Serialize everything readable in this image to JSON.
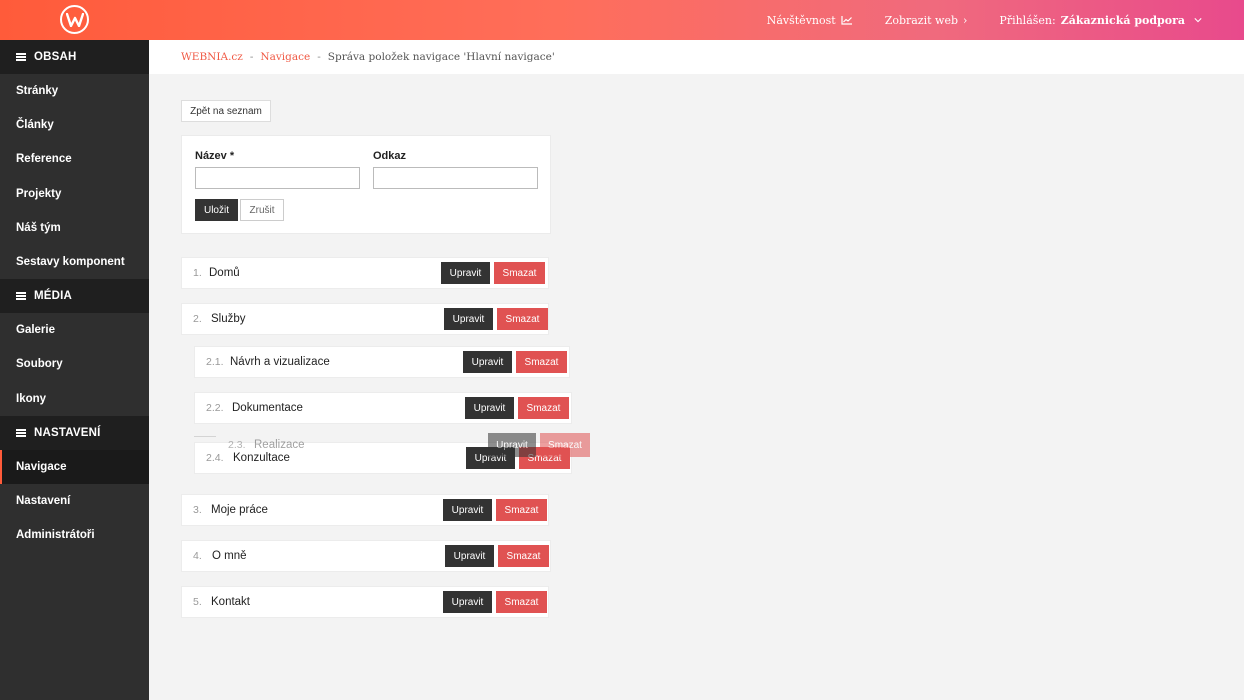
{
  "topbar": {
    "logo_icon": "webnia-w-logo",
    "visits_label": "Návštěvnost",
    "show_web_label": "Zobrazit web",
    "logged_in_label": "Přihlášen:",
    "user_name": "Zákaznická podpora"
  },
  "sidebar": {
    "sections": [
      {
        "title": "OBSAH",
        "items": [
          "Stránky",
          "Články",
          "Reference",
          "Projekty",
          "Náš tým",
          "Sestavy komponent"
        ]
      },
      {
        "title": "MÉDIA",
        "items": [
          "Galerie",
          "Soubory",
          "Ikony"
        ]
      },
      {
        "title": "NASTAVENÍ",
        "items": [
          "Navigace",
          "Nastavení",
          "Administrátoři"
        ]
      }
    ],
    "active_item": "Navigace"
  },
  "breadcrumb": {
    "items": [
      "WEBNIA.cz",
      "Navigace",
      "Správa položek navigace 'Hlavní navigace'"
    ],
    "separator": "-"
  },
  "back_button": "Zpět na seznam",
  "form": {
    "name_label": "Název *",
    "name_value": "",
    "link_label": "Odkaz",
    "link_value": "",
    "save_label": "Uložit",
    "cancel_label": "Zrušit"
  },
  "nav_items": [
    {
      "num": "1.",
      "name": "Domů",
      "edit": "Upravit",
      "delete": "Smazat"
    },
    {
      "num": "2.",
      "name": "Služby",
      "edit": "Upravit",
      "delete": "Smazat"
    },
    {
      "num": "2.1.",
      "name": "Návrh a vizualizace",
      "edit": "Upravit",
      "delete": "Smazat"
    },
    {
      "num": "2.2.",
      "name": "Dokumentace",
      "edit": "Upravit",
      "delete": "Smazat"
    },
    {
      "num": "2.4.",
      "name": "Konzultace",
      "edit": "Upravit",
      "delete": "Smazat"
    },
    {
      "num": "3.",
      "name": "Moje práce",
      "edit": "Upravit",
      "delete": "Smazat"
    },
    {
      "num": "4.",
      "name": "O mně",
      "edit": "Upravit",
      "delete": "Smazat"
    },
    {
      "num": "5.",
      "name": "Kontakt",
      "edit": "Upravit",
      "delete": "Smazat"
    }
  ],
  "dragging_item": {
    "num": "2.3.",
    "name": "Realizace",
    "edit": "Upravit",
    "delete": "Smazat"
  },
  "colors": {
    "accent": "#ff5b3a",
    "danger": "#e05252",
    "dark": "#333333",
    "sidebar": "#2f2f2f"
  }
}
